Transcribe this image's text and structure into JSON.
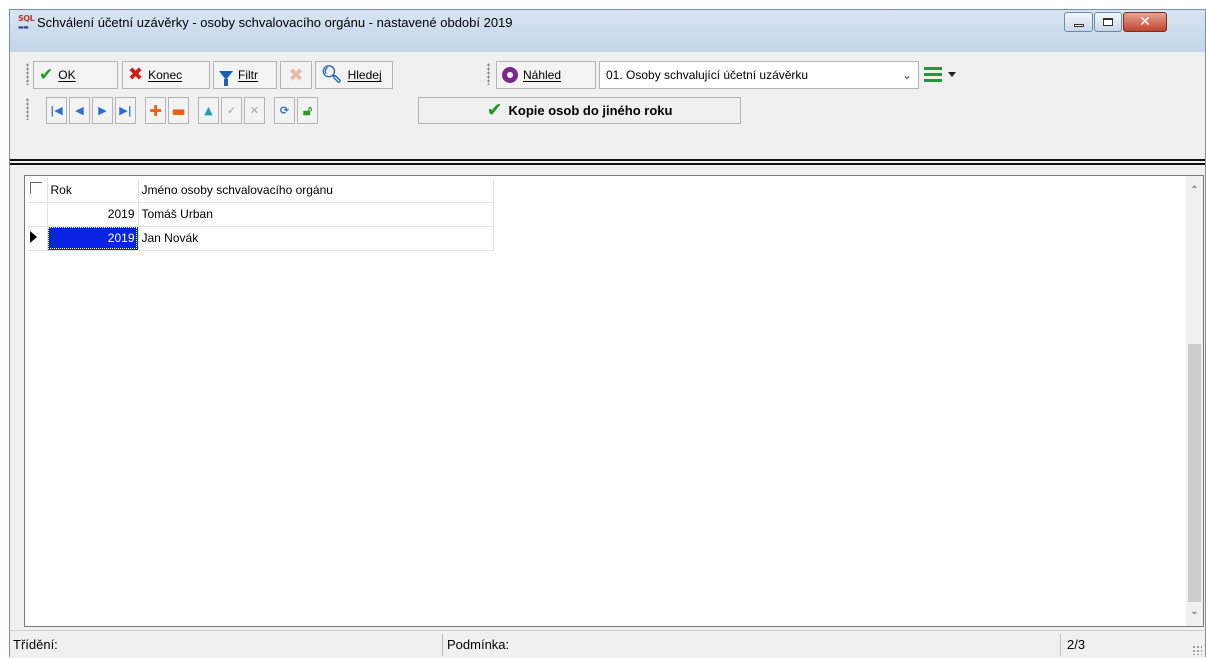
{
  "window": {
    "title": "Schválení účetní uzávěrky - osoby schvalovacího orgánu - nastavené období 2019",
    "app_icon": "SQL"
  },
  "toolbar": {
    "ok_label": "OK",
    "konec_label": "Konec",
    "filtr_label": "Filtr",
    "hledej_label": "Hledej",
    "nahled_label": "Náhled",
    "view_select_value": "01. Osoby schvalující účetní uzávěrku",
    "kopie_label": "Kopie osob do jiného roku"
  },
  "nav_buttons": [
    "first-record",
    "prev-record",
    "next-record",
    "last-record",
    "add-record",
    "delete-record",
    "edit-up",
    "confirm",
    "cancel",
    "refresh",
    "unlock"
  ],
  "grid": {
    "columns": [
      "Rok",
      "Jméno osoby schvalovacího orgánu"
    ],
    "rows": [
      {
        "rok": "2019",
        "jmeno": "Tomáš Urban"
      },
      {
        "rok": "2019",
        "jmeno": "Jan Novák"
      }
    ],
    "selected_row": 1
  },
  "status": {
    "trideni_label": "Třídění:",
    "podminka_label": "Podmínka:",
    "record_counter": "2/3"
  },
  "colors": {
    "accent_green": "#1e9a1e",
    "accent_red": "#d51a1a",
    "selection_blue": "#0a24e6"
  }
}
